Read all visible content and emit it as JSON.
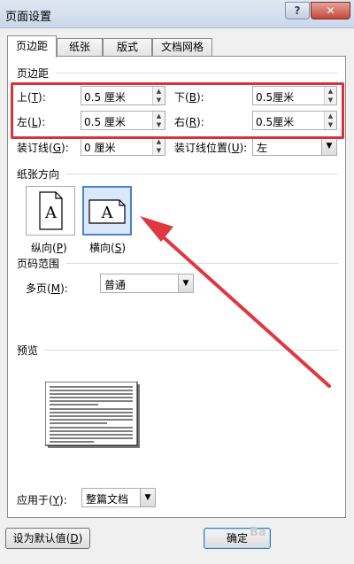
{
  "window": {
    "title": "页面设置",
    "help": "?",
    "close": "✕"
  },
  "tabs": [
    {
      "label": "页边距"
    },
    {
      "label": "纸张"
    },
    {
      "label": "版式"
    },
    {
      "label": "文档网格"
    }
  ],
  "margins": {
    "section_title": "页边距",
    "top": {
      "label": "上",
      "key": "T",
      "value": "0.5 厘米"
    },
    "bottom": {
      "label": "下",
      "key": "B",
      "value": "0.5厘米"
    },
    "left": {
      "label": "左",
      "key": "L",
      "value": "0.5 厘米"
    },
    "right": {
      "label": "右",
      "key": "R",
      "value": "0.5厘米"
    },
    "gutter": {
      "label": "装订线",
      "key": "G",
      "value": "0 厘米"
    },
    "gutter_pos": {
      "label": "装订线位置",
      "key": "U",
      "value": "左"
    }
  },
  "orientation": {
    "section_title": "纸张方向",
    "portrait": {
      "label": "纵向",
      "key": "P",
      "glyph": "A"
    },
    "landscape": {
      "label": "横向",
      "key": "S",
      "glyph": "A"
    }
  },
  "pages": {
    "section_title": "页码范围",
    "multiple": {
      "label": "多页",
      "key": "M",
      "value": "普通"
    }
  },
  "preview": {
    "section_title": "预览"
  },
  "apply_to": {
    "label": "应用于",
    "key": "Y",
    "value": "整篇文档"
  },
  "buttons": {
    "set_default": "设为默认值",
    "set_default_key": "D",
    "ok": "确定"
  },
  "watermark": "Ba"
}
